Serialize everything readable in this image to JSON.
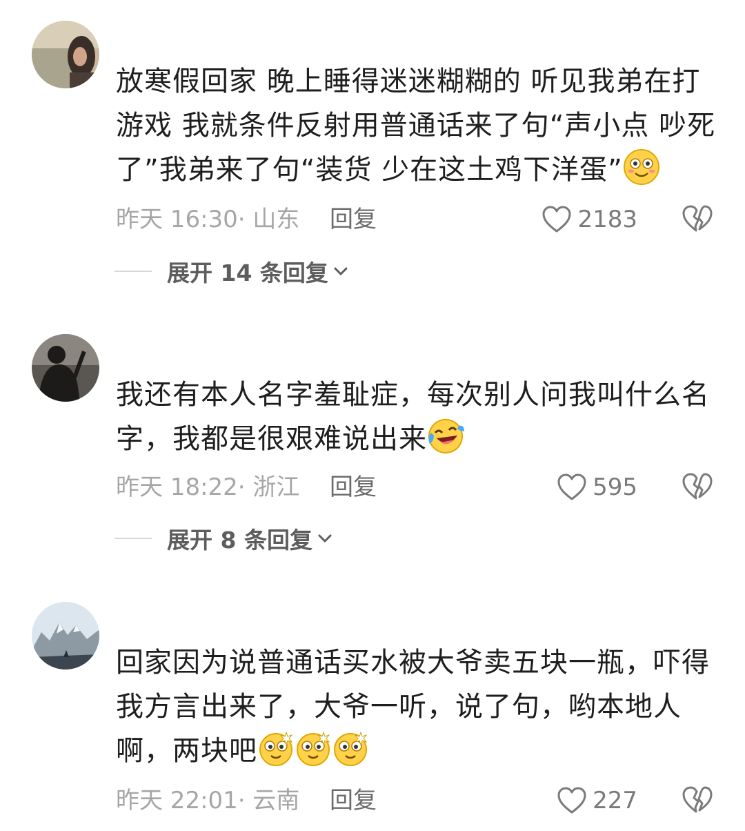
{
  "comments": [
    {
      "text": "放寒假回家 晚上睡得迷迷糊糊的 听见我弟在打游戏 我就条件反射用普通话来了句“声小点 吵死了”我弟来了句“装货 少在这土鸡下洋蛋”",
      "emoji": [
        "smile-emoji"
      ],
      "time_location": "昨天 16:30· 山东",
      "reply_label": "回复",
      "likes": "2183",
      "expand_label": "展开 14 条回复"
    },
    {
      "text": "我还有本人名字羞耻症，每次别人问我叫什么名字，我都是很艰难说出来",
      "emoji": [
        "laugh-cry-emoji"
      ],
      "time_location": "昨天 18:22· 浙江",
      "reply_label": "回复",
      "likes": "595",
      "expand_label": "展开 8 条回复"
    },
    {
      "text": "回家因为说普通话买水被大爷卖五块一瓶，吓得我方言出来了，大爷一听，说了句，哟本地人啊，两块吧",
      "emoji": [
        "dizzy-emoji",
        "dizzy-emoji",
        "dizzy-emoji"
      ],
      "time_location": "昨天 22:01· 云南",
      "reply_label": "回复",
      "likes": "227"
    }
  ],
  "colors": {
    "meta_gray": "#a6a6a6",
    "icon_gray": "#7a7a7a",
    "text_dark": "#1e1e1e"
  }
}
